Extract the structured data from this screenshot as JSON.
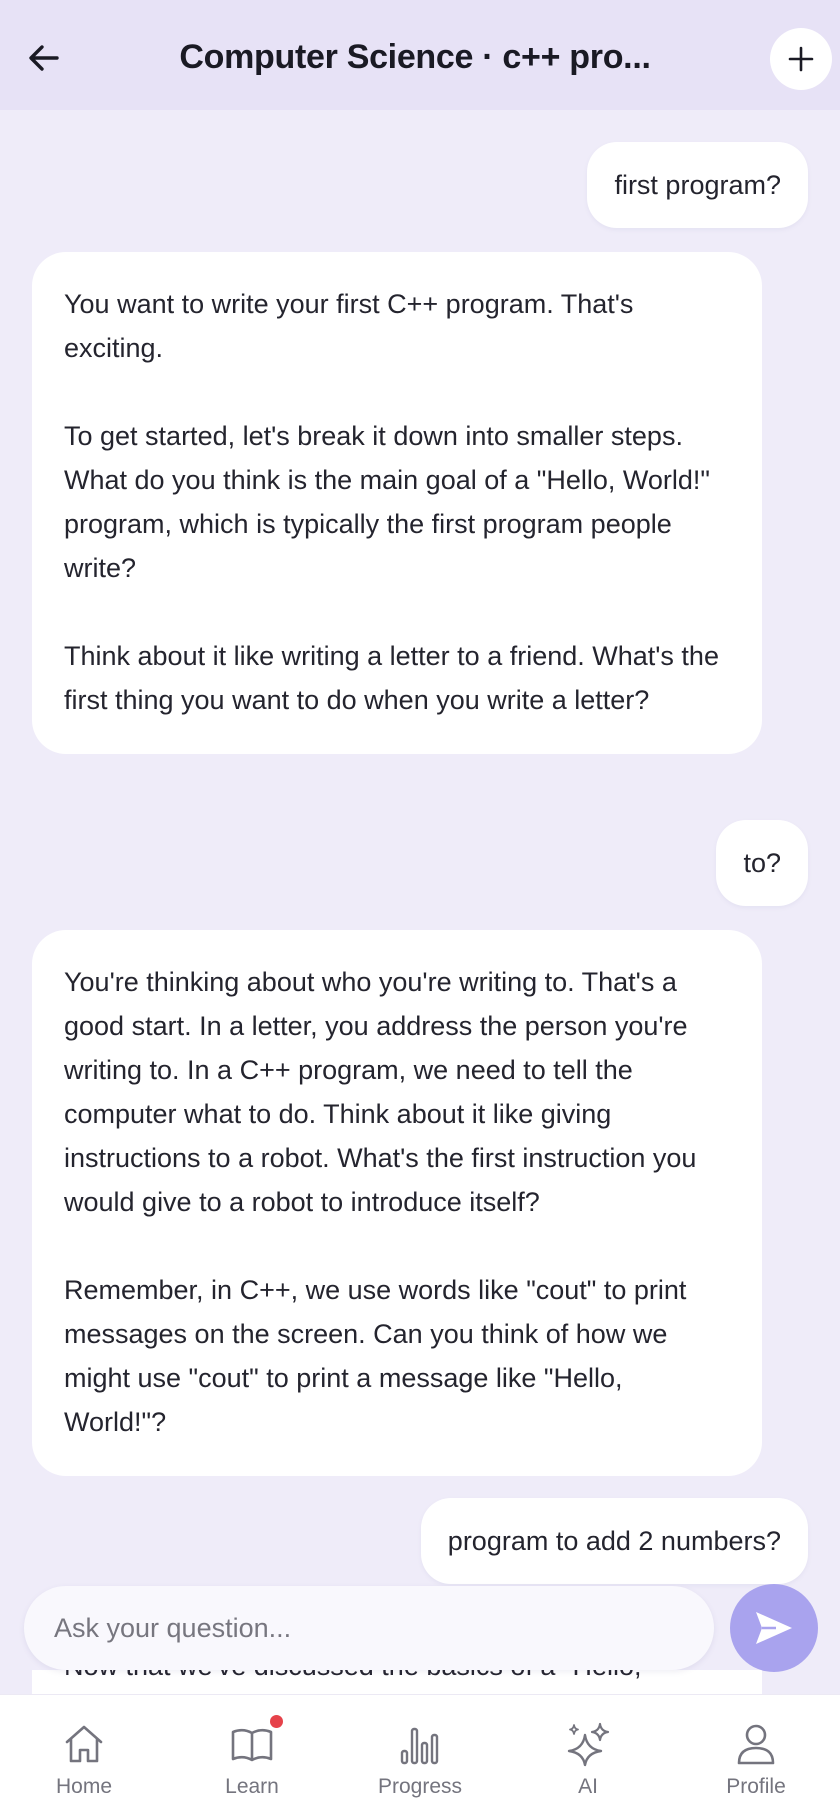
{
  "header": {
    "title": "Computer Science · c++ pro..."
  },
  "messages": [
    {
      "role": "user",
      "text": "first program?"
    },
    {
      "role": "assistant",
      "paragraphs": [
        "You want to write your first C++ program. That's exciting.",
        "To get started, let's break it down into smaller steps. What do you think is the main goal of a \"Hello, World!\" program, which is typically the first program people write?",
        "Think about it like writing a letter to a friend. What's the first thing you want to do when you write a letter?"
      ]
    },
    {
      "role": "user",
      "text": "to?"
    },
    {
      "role": "assistant",
      "paragraphs": [
        "You're thinking about who you're writing to. That's a good start. In a letter, you address the person you're writing to. In a C++ program, we need to tell the computer what to do. Think about it like giving instructions to a robot. What's the first instruction you would give to a robot to introduce itself?",
        "Remember, in C++, we use words like \"cout\" to print messages on the screen. Can you think of how we might use \"cout\" to print a message like \"Hello, World!\"?"
      ]
    },
    {
      "role": "user",
      "text": "program to add 2 numbers?"
    },
    {
      "role": "assistant",
      "paragraphs": [
        "Now that we've discussed the basics of a \"Hello,"
      ]
    }
  ],
  "composer": {
    "placeholder": "Ask your question..."
  },
  "nav": [
    {
      "label": "Home",
      "icon": "home-icon"
    },
    {
      "label": "Learn",
      "icon": "book-icon",
      "badge": true
    },
    {
      "label": "Progress",
      "icon": "bar-chart-icon"
    },
    {
      "label": "AI",
      "icon": "sparkles-icon"
    },
    {
      "label": "Profile",
      "icon": "user-icon"
    }
  ],
  "colors": {
    "background": "#efecf9",
    "header": "#e7e2f6",
    "send_button": "#a9a3ee",
    "badge": "#e6424a"
  }
}
